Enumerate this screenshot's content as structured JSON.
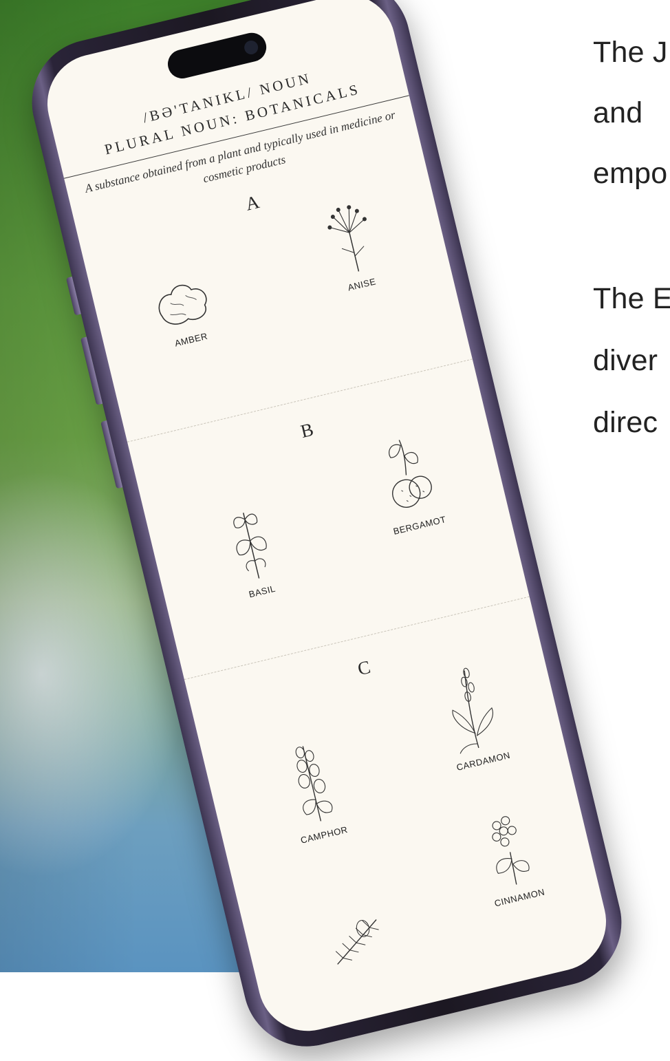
{
  "side_text": {
    "line1": "The J",
    "line2": "and",
    "line3": "empo",
    "line4": "The E",
    "line5": "diver",
    "line6": "direc"
  },
  "phone": {
    "phonetic": "/BƏ'TANIKL/ NOUN",
    "plural": "PLURAL NOUN: BOTANICALS",
    "definition": "A substance obtained from a plant and typically used in medicine or cosmetic products",
    "sections": [
      {
        "letter": "A",
        "items": [
          "AMBER",
          "ANISE"
        ]
      },
      {
        "letter": "B",
        "items": [
          "BASIL",
          "BERGAMOT"
        ]
      },
      {
        "letter": "C",
        "items": [
          "CAMPHOR",
          "CARDAMON",
          "CINNAMON"
        ]
      }
    ]
  }
}
